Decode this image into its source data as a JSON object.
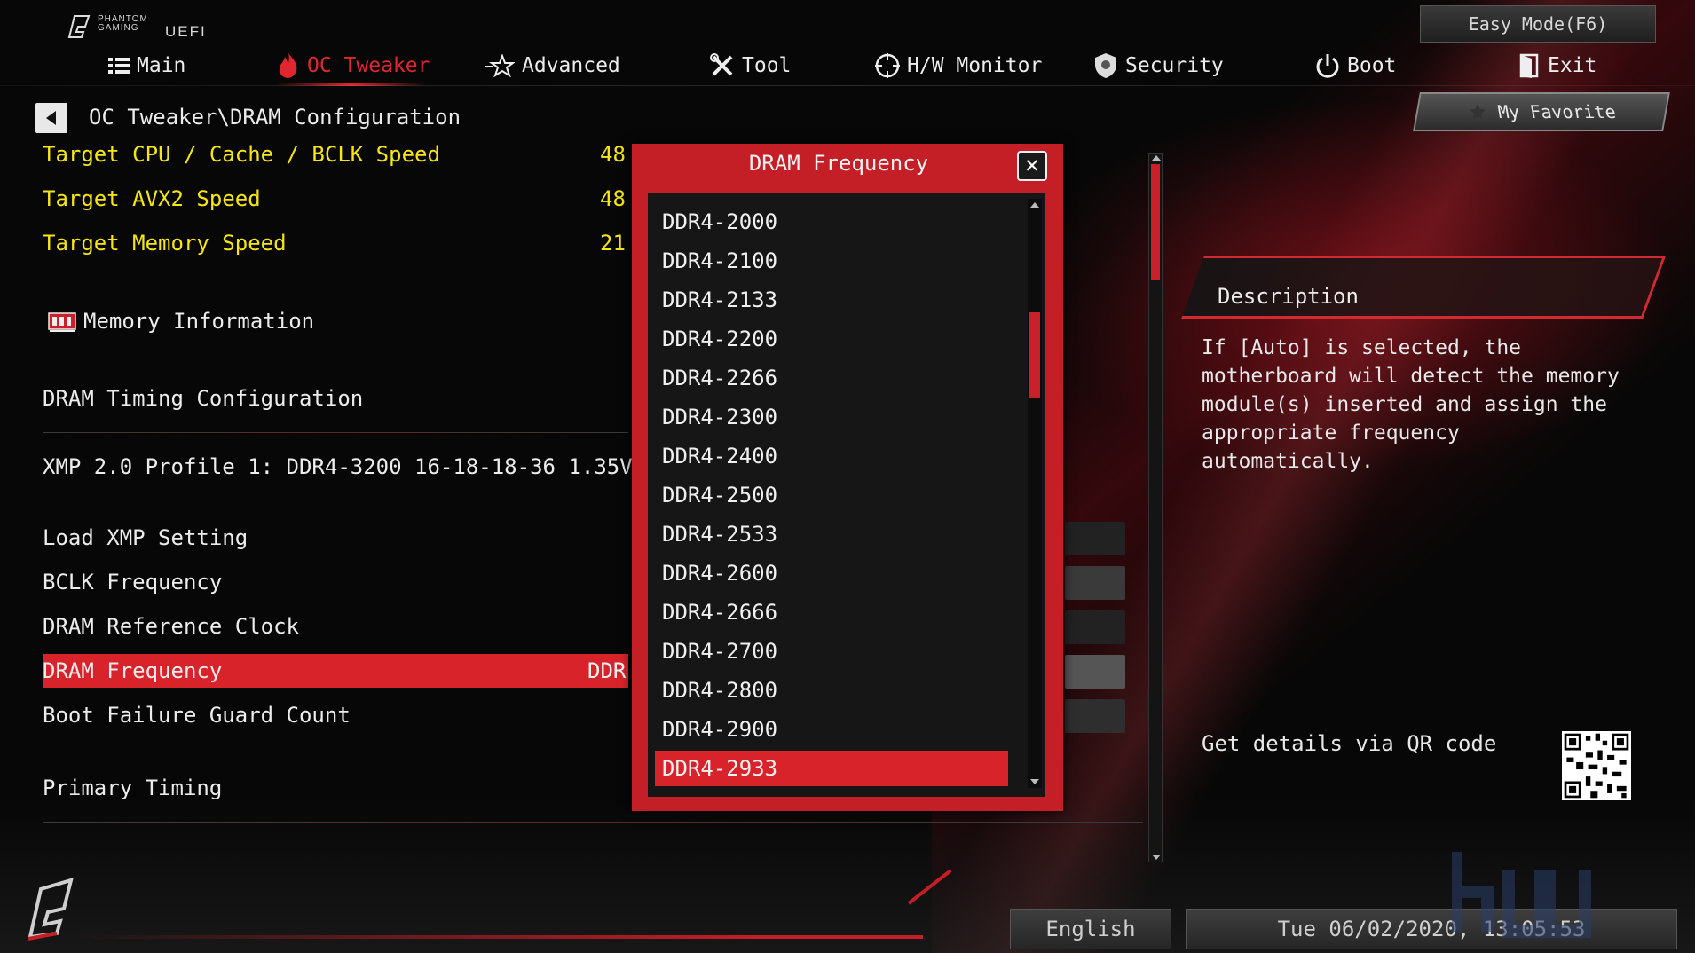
{
  "brand": {
    "line1": "PHANTOM",
    "line2": "GAMING",
    "product": "UEFI"
  },
  "nav": {
    "items": [
      {
        "label": "Main",
        "icon": "list-icon",
        "active": false
      },
      {
        "label": "OC Tweaker",
        "icon": "flame-icon",
        "active": true
      },
      {
        "label": "Advanced",
        "icon": "star-icon",
        "active": false
      },
      {
        "label": "Tool",
        "icon": "tools-icon",
        "active": false
      },
      {
        "label": "H/W Monitor",
        "icon": "monitor-icon",
        "active": false
      },
      {
        "label": "Security",
        "icon": "shield-icon",
        "active": false
      },
      {
        "label": "Boot",
        "icon": "power-icon",
        "active": false
      },
      {
        "label": "Exit",
        "icon": "exit-door-icon",
        "active": false
      }
    ],
    "easy_mode": "Easy Mode(F6)",
    "my_favorite": "My Favorite"
  },
  "breadcrumb": "OC Tweaker\\DRAM Configuration",
  "targets": [
    {
      "label": "Target CPU / Cache / BCLK Speed",
      "value": "48"
    },
    {
      "label": "Target AVX2 Speed",
      "value": "48"
    },
    {
      "label": "Target Memory Speed",
      "value": "21"
    }
  ],
  "settings": {
    "memory_information": "Memory Information",
    "dram_timing": "DRAM Timing Configuration",
    "xmp_profile": "XMP 2.0 Profile 1: DDR4-3200 16-18-18-36 1.35V",
    "load_xmp": "Load XMP Setting",
    "bclk_frequency": "BCLK Frequency",
    "dram_ref_clock": "DRAM Reference Clock",
    "dram_frequency": "DRAM Frequency",
    "dram_frequency_value": "DDR",
    "boot_failure": "Boot Failure Guard Count",
    "primary_timing": "Primary Timing"
  },
  "dialog": {
    "title": "DRAM Frequency",
    "options": [
      "DDR4-2000",
      "DDR4-2100",
      "DDR4-2133",
      "DDR4-2200",
      "DDR4-2266",
      "DDR4-2300",
      "DDR4-2400",
      "DDR4-2500",
      "DDR4-2533",
      "DDR4-2600",
      "DDR4-2666",
      "DDR4-2700",
      "DDR4-2800",
      "DDR4-2900",
      "DDR4-2933"
    ],
    "selected": "DDR4-2933"
  },
  "description": {
    "title": "Description",
    "text": "If [Auto] is selected, the motherboard will detect the memory module(s) inserted and assign the appropriate frequency automatically.",
    "qr_label": "Get details via QR code"
  },
  "footer": {
    "language": "English",
    "datetime": "Tue 06/02/2020, 13:05:53"
  },
  "colors": {
    "accent_red": "#d9232b",
    "highlight_yellow": "#f5e614"
  }
}
